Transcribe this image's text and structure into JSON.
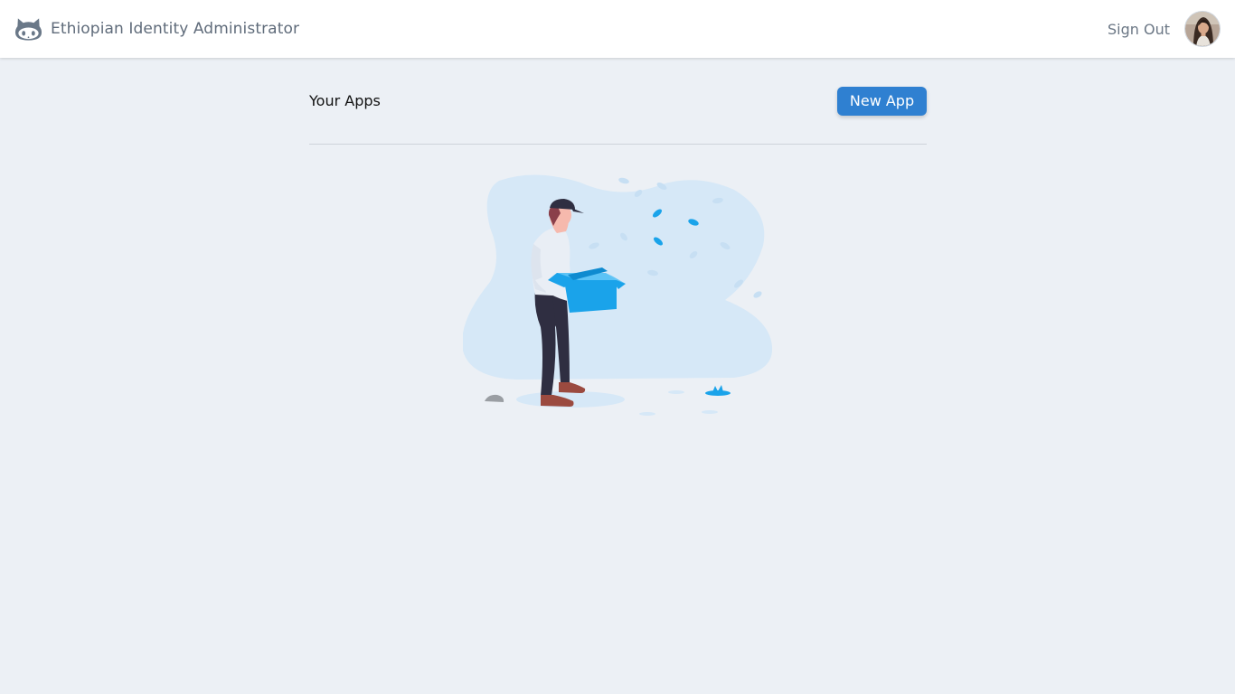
{
  "navbar": {
    "title": "Ethiopian Identity Administrator",
    "logo_icon": "github-octocat-icon",
    "sign_out_label": "Sign Out",
    "avatar_icon": "user-avatar"
  },
  "main": {
    "title": "Your Apps",
    "new_app_label": "New App",
    "empty_state_icon": "empty-box-illustration"
  },
  "colors": {
    "page_background": "#ecf0f5",
    "navbar_background": "#ffffff",
    "accent": "#2f80d1",
    "illustration_blob": "#d6e8f7",
    "illustration_accent": "#1aa3ea"
  }
}
